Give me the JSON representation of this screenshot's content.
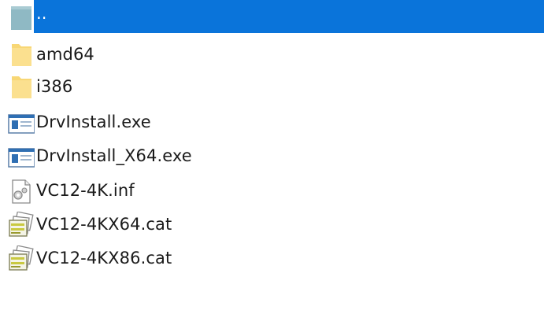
{
  "files": [
    {
      "name": "..",
      "icon": "parent-folder-icon",
      "selected": true
    },
    {
      "name": "amd64",
      "icon": "folder-icon",
      "selected": false
    },
    {
      "name": "i386",
      "icon": "folder-icon",
      "selected": false
    },
    {
      "name": "DrvInstall.exe",
      "icon": "executable-icon",
      "selected": false
    },
    {
      "name": "DrvInstall_X64.exe",
      "icon": "executable-icon",
      "selected": false
    },
    {
      "name": "VC12-4K.inf",
      "icon": "setup-info-icon",
      "selected": false
    },
    {
      "name": "VC12-4KX64.cat",
      "icon": "security-catalog-icon",
      "selected": false
    },
    {
      "name": "VC12-4KX86.cat",
      "icon": "security-catalog-icon",
      "selected": false
    }
  ],
  "colors": {
    "selection": "#0a74da",
    "folder": "#f8d775",
    "text": "#1a1a1a"
  }
}
